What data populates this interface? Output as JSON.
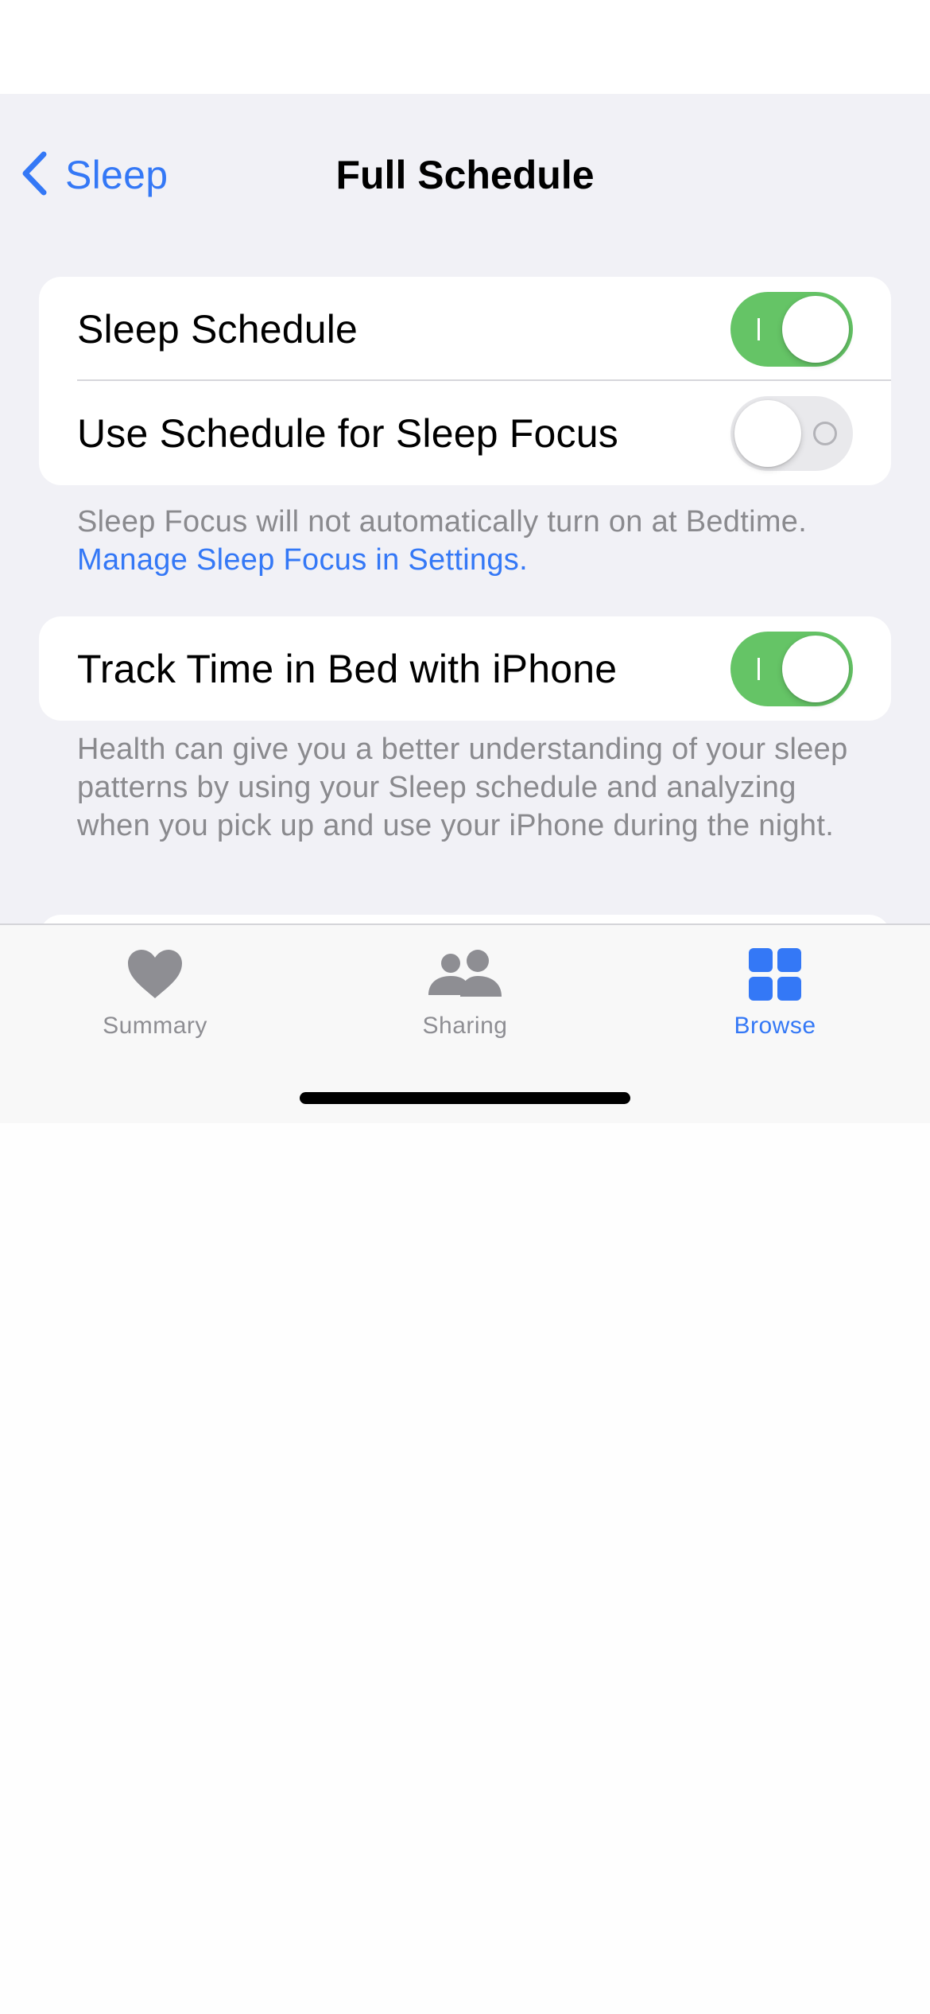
{
  "nav": {
    "back_label": "Sleep",
    "title": "Full Schedule"
  },
  "schedule_group": {
    "rows": [
      {
        "label": "Sleep Schedule",
        "toggle_on": true
      },
      {
        "label": "Use Schedule for Sleep Focus",
        "toggle_on": false
      }
    ],
    "footer": "Sleep Focus will not automatically turn on at Bedtime.",
    "footer_link": "Manage Sleep Focus in Settings."
  },
  "track_group": {
    "rows": [
      {
        "label": "Track Time in Bed with iPhone",
        "toggle_on": true
      }
    ],
    "footer": "Health can give you a better understanding of your sleep patterns by using your Sleep schedule and analyzing when you pick up and use your iPhone during the night."
  },
  "tab_bar": {
    "tabs": [
      {
        "label": "Summary",
        "icon": "heart-icon",
        "active": false
      },
      {
        "label": "Sharing",
        "icon": "people-icon",
        "active": false
      },
      {
        "label": "Browse",
        "icon": "grid-icon",
        "active": true
      }
    ]
  },
  "colors": {
    "accent": "#3478f6",
    "toggle_on": "#65c466",
    "toggle_off": "#e9e9ec",
    "grouped_background": "#f1f1f6",
    "secondary_text": "#8a8a8e",
    "inactive_tab": "#8e8e93"
  }
}
